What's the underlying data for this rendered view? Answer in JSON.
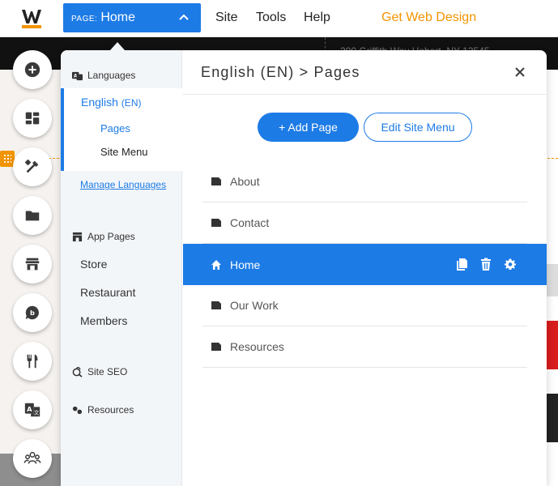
{
  "topbar": {
    "page_prefix": "PAGE:",
    "page_name": "Home",
    "nav_site": "Site",
    "nav_tools": "Tools",
    "nav_help": "Help",
    "get_design": "Get Web Design"
  },
  "preview": {
    "address_fragment": "200 Griffith Way Hobart, NY 13545"
  },
  "rail": {
    "icons": [
      "add-icon",
      "layout-icon",
      "design-icon",
      "folder-icon",
      "store-icon",
      "blog-icon",
      "restaurant-icon",
      "translate-icon",
      "members-icon"
    ]
  },
  "panel": {
    "sidebar": {
      "languages_head": "Languages",
      "lang_name": "English",
      "lang_code": "(EN)",
      "sub_pages": "Pages",
      "sub_menu": "Site Menu",
      "manage_link": "Manage Languages",
      "app_pages_head": "App Pages",
      "app_items": [
        "Store",
        "Restaurant",
        "Members"
      ],
      "site_seo": "Site SEO",
      "resources": "Resources"
    },
    "main": {
      "title": "English (EN) > Pages",
      "add_page": "+ Add Page",
      "edit_menu": "Edit Site Menu",
      "pages": [
        {
          "label": "About",
          "icon": "page-icon",
          "active": false
        },
        {
          "label": "Contact",
          "icon": "page-icon",
          "active": false
        },
        {
          "label": "Home",
          "icon": "home-icon",
          "active": true
        },
        {
          "label": "Our Work",
          "icon": "page-icon",
          "active": false
        },
        {
          "label": "Resources",
          "icon": "page-icon",
          "active": false
        }
      ]
    }
  },
  "colors": {
    "accent": "#1d7be6",
    "orange": "#f29400"
  }
}
